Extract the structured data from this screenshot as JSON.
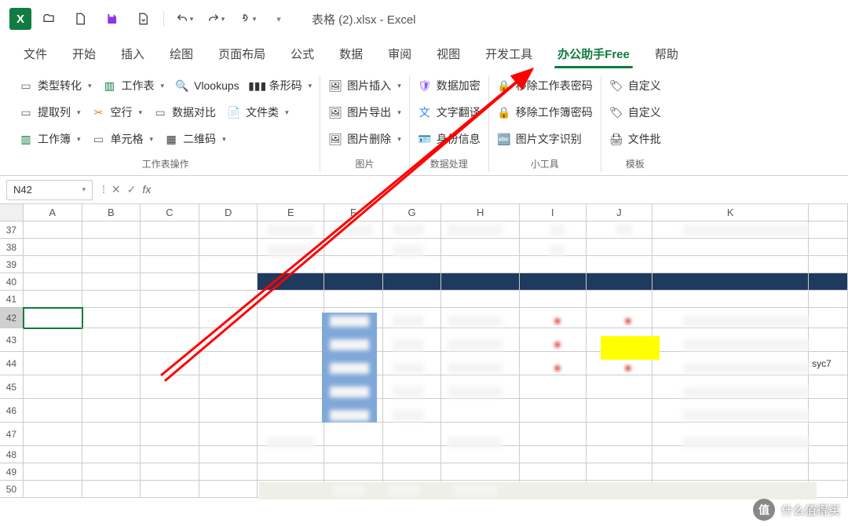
{
  "title": "表格 (2).xlsx  -  Excel",
  "tabs": [
    "文件",
    "开始",
    "插入",
    "绘图",
    "页面布局",
    "公式",
    "数据",
    "审阅",
    "视图",
    "开发工具",
    "办公助手Free",
    "帮助"
  ],
  "active_tab": 10,
  "ribbon": {
    "group1": {
      "label": "工作表操作",
      "r1": {
        "type_convert": "类型转化",
        "worksheet": "工作表",
        "vlookups": "Vlookups",
        "barcode": "条形码"
      },
      "r2": {
        "extract_col": "提取列",
        "blank_row": "空行",
        "data_compare": "数据对比",
        "file_type": "文件类"
      },
      "r3": {
        "workbook": "工作簿",
        "cell": "单元格",
        "qrcode": "二维码"
      }
    },
    "group2": {
      "label": "图片",
      "img_insert": "图片插入",
      "img_export": "图片导出",
      "img_delete": "图片删除"
    },
    "group3": {
      "label": "数据处理",
      "data_encrypt": "数据加密",
      "text_translate": "文字翻译",
      "id_info": "身份信息"
    },
    "group4": {
      "label": "小工具",
      "remove_sheet_pwd": "移除工作表密码",
      "remove_book_pwd": "移除工作簿密码",
      "img_ocr": "图片文字识别"
    },
    "group5": {
      "label": "模板",
      "custom1": "自定义",
      "custom2": "自定义",
      "file_batch": "文件批"
    }
  },
  "name_box": "N42",
  "columns": [
    "A",
    "B",
    "C",
    "D",
    "E",
    "F",
    "G",
    "H",
    "I",
    "J",
    "K",
    ""
  ],
  "row_nums": [
    37,
    38,
    39,
    40,
    41,
    42,
    43,
    44,
    45,
    46,
    47,
    48,
    49,
    50
  ],
  "right_text": "syc7",
  "watermark": {
    "badge": "值",
    "text": "什么值得买"
  }
}
